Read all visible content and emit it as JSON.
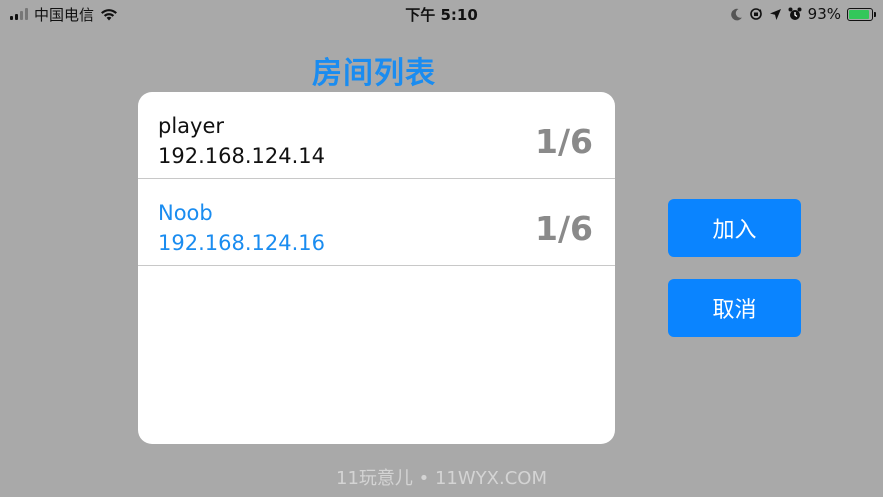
{
  "status_bar": {
    "carrier": "中国电信",
    "time": "下午 5:10",
    "battery_percent": "93%",
    "battery_level": 0.93,
    "icons": [
      "signal-icon",
      "wifi-icon",
      "moon-icon",
      "orientation-lock-icon",
      "location-icon",
      "alarm-icon",
      "battery-icon"
    ]
  },
  "title": "房间列表",
  "rooms": [
    {
      "name": "player",
      "ip": "192.168.124.14",
      "players": "1/6",
      "selected": false
    },
    {
      "name": "Noob",
      "ip": "192.168.124.16",
      "players": "1/6",
      "selected": true
    }
  ],
  "buttons": {
    "join_label": "加入",
    "cancel_label": "取消"
  },
  "watermark": "11玩意儿 • 11WYX.COM",
  "colors": {
    "background": "#a9a9a9",
    "accent": "#1a8cf0",
    "button": "#0a84ff",
    "count_gray": "#8a8a8a",
    "battery_green": "#33c75a"
  }
}
